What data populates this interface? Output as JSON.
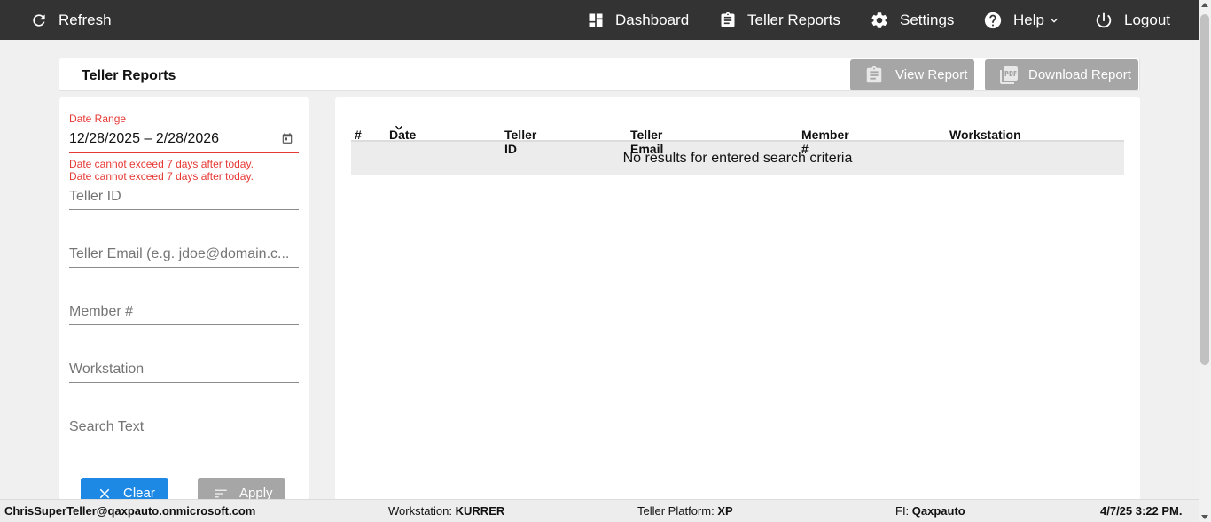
{
  "nav": {
    "refresh": "Refresh",
    "dashboard": "Dashboard",
    "teller_reports": "Teller Reports",
    "settings": "Settings",
    "help": "Help",
    "logout": "Logout"
  },
  "header": {
    "title": "Teller Reports",
    "view_report": "View Report",
    "download_report": "Download Report"
  },
  "filters": {
    "date_range_label": "Date Range",
    "date_range_value": "12/28/2025 – 2/28/2026",
    "errors": [
      "Date cannot exceed 7 days after today.",
      "Date cannot exceed 7 days after today."
    ],
    "teller_id_placeholder": "Teller ID",
    "teller_email_placeholder": "Teller Email (e.g. jdoe@domain.c...",
    "member_placeholder": "Member #",
    "workstation_placeholder": "Workstation",
    "search_text_placeholder": "Search Text",
    "clear": "Clear",
    "apply": "Apply"
  },
  "table": {
    "columns": [
      "#",
      "Date",
      "Teller ID",
      "Teller Email",
      "Member #",
      "Workstation"
    ],
    "empty_message": "No results for entered search criteria"
  },
  "status": {
    "user": "ChrisSuperTeller@qaxpauto.onmicrosoft.com",
    "workstation_label": "Workstation:",
    "workstation_value": "KURRER",
    "platform_label": "Teller Platform:",
    "platform_value": "XP",
    "fi_label": "FI:",
    "fi_value": "Qaxpauto",
    "datetime": "4/7/25 3:22 PM."
  },
  "colors": {
    "nav_bg": "#333333",
    "error": "#e53935",
    "primary": "#1e88e5",
    "disabled": "#a6a6a6"
  }
}
